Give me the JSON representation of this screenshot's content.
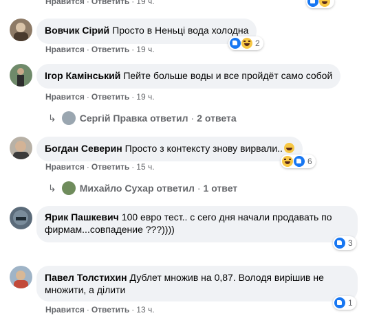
{
  "top_partial": {
    "like": "Нравится",
    "reply": "Ответить",
    "time": "19 ч."
  },
  "comments": [
    {
      "author": "Вовчик Сірий",
      "text": "Просто в Неньці вода холодна",
      "like": "Нравится",
      "reply": "Ответить",
      "time": "19 ч.",
      "reactions": {
        "types": [
          "like",
          "haha"
        ],
        "count": "2"
      }
    },
    {
      "author": "Ігор Камінський",
      "text": "Пейте больше воды и все пройдёт само собой",
      "like": "Нравится",
      "reply": "Ответить",
      "time": "19 ч.",
      "replies": {
        "name": "Сергій Правка",
        "verb": "ответил",
        "count": "2 ответа"
      }
    },
    {
      "author": "Богдан Северин",
      "text": "Просто з контексту знову вирвали..",
      "like": "Нравится",
      "reply": "Ответить",
      "time": "15 ч.",
      "reactions": {
        "types": [
          "haha",
          "like"
        ],
        "count": "6"
      },
      "replies": {
        "name": "Михайло Сухар",
        "verb": "ответил",
        "count": "1 ответ"
      }
    },
    {
      "author": "Ярик Пашкевич",
      "text_line1": "100 евро тест.. с сего дня начали продавать по",
      "text_line2": "фирмам...совпадение ???))))",
      "reactions": {
        "types": [
          "like"
        ],
        "count": "3"
      }
    },
    {
      "author": "Павел Толстихин",
      "text_line1": "Дублет множив на 0,87. Володя вирішив не",
      "text_line2": "множити, а ділити",
      "like": "Нравится",
      "reply": "Ответить",
      "time": "13 ч.",
      "reactions": {
        "types": [
          "like"
        ],
        "count": "1"
      }
    }
  ],
  "colors": {
    "bubble": "#f0f2f5",
    "meta": "#65676b",
    "like_blue": "#1877f2",
    "haha_yellow": "#f7c744"
  }
}
